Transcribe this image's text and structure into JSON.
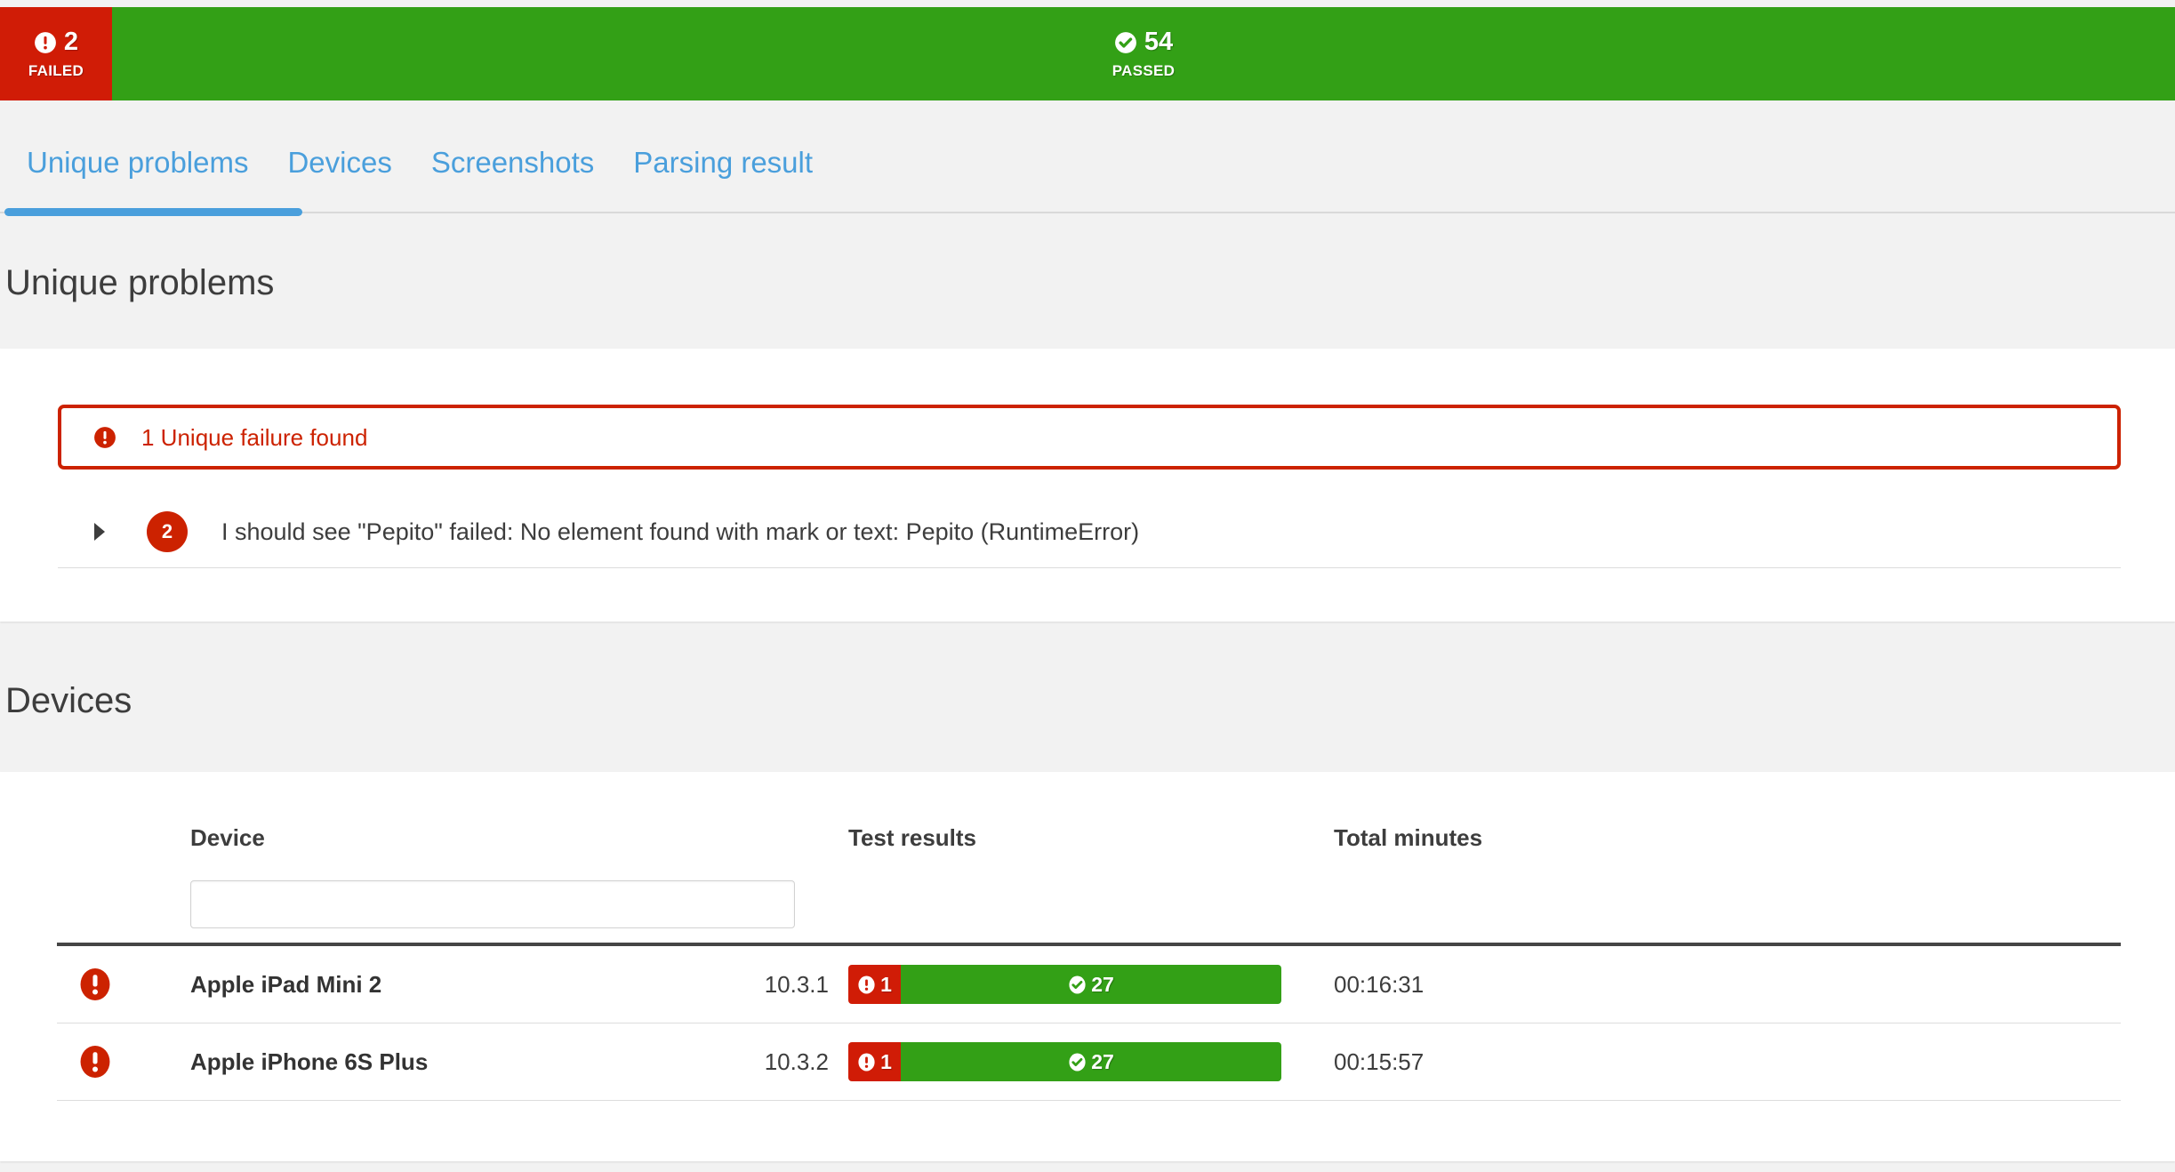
{
  "summary": {
    "failed": {
      "count": "2",
      "label": "FAILED",
      "icon": "error-icon",
      "color": "#d01c06"
    },
    "passed": {
      "count": "54",
      "label": "PASSED",
      "icon": "check-circle-icon",
      "color": "#33a016"
    }
  },
  "tabs": [
    {
      "label": "Unique problems",
      "active": true
    },
    {
      "label": "Devices",
      "active": false
    },
    {
      "label": "Screenshots",
      "active": false
    },
    {
      "label": "Parsing result",
      "active": false
    }
  ],
  "unique_problems": {
    "heading": "Unique problems",
    "alert": {
      "icon": "error-icon",
      "text": "1 Unique failure found",
      "color": "#cc2200"
    },
    "failures": [
      {
        "caret": "caret-right-icon",
        "count": "2",
        "text": "I should see \"Pepito\" failed: No element found with mark or text: Pepito (RuntimeError)"
      }
    ]
  },
  "devices": {
    "heading": "Devices",
    "columns": {
      "device": "Device",
      "test_results": "Test results",
      "total_minutes": "Total minutes"
    },
    "filter": {
      "value": "",
      "placeholder": ""
    },
    "rows": [
      {
        "status_icon": "error-icon",
        "name": "Apple iPad Mini 2",
        "version": "10.3.1",
        "failed": "1",
        "passed": "27",
        "total_minutes": "00:16:31"
      },
      {
        "status_icon": "error-icon",
        "name": "Apple iPhone 6S Plus",
        "version": "10.3.2",
        "failed": "1",
        "passed": "27",
        "total_minutes": "00:15:57"
      }
    ]
  },
  "colors": {
    "fail_red": "#d01c06",
    "pass_green": "#33a016",
    "alert_red": "#cc2200",
    "link_blue": "#4a9fdc",
    "page_bg": "#f2f2f2",
    "text_dark": "#3d3d3d"
  }
}
